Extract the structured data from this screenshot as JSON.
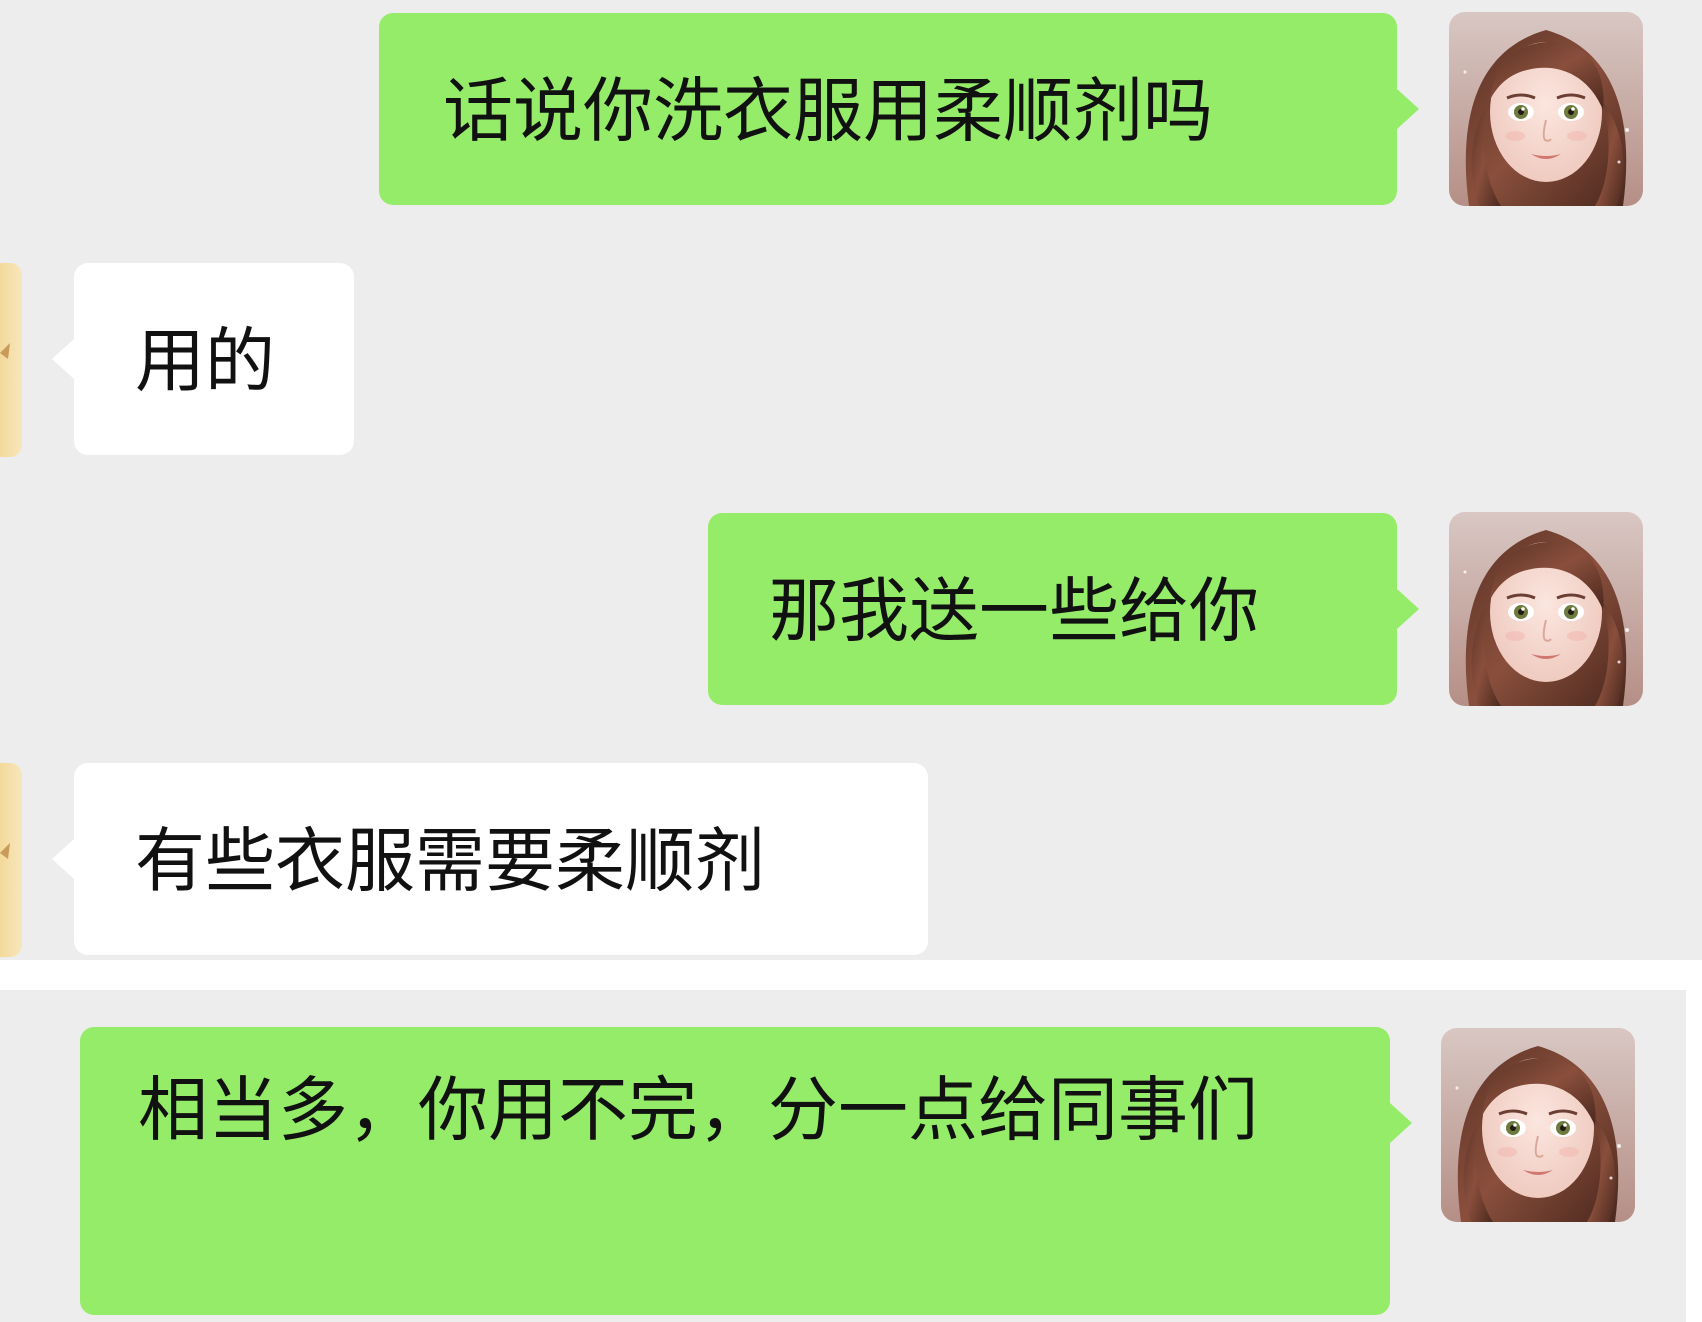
{
  "messages": [
    {
      "sender": "me",
      "text": "话说你洗衣服用柔顺剂吗"
    },
    {
      "sender": "other",
      "text": "用的"
    },
    {
      "sender": "me",
      "text": "那我送一些给你"
    },
    {
      "sender": "other",
      "text": "有些衣服需要柔顺剂"
    },
    {
      "sender": "me",
      "text": "相当多，你用不完，分一点给同事们"
    }
  ],
  "colors": {
    "chat_background": "#ededed",
    "my_bubble": "#95ec69",
    "their_bubble": "#ffffff",
    "text": "#111111"
  },
  "icons": {
    "my_avatar": "girl-portrait-avatar",
    "their_avatar": "partially-visible-avatar"
  }
}
